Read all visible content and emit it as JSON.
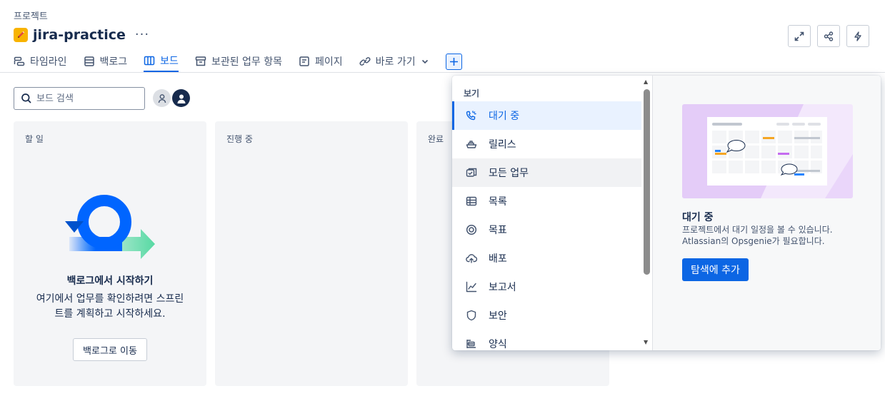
{
  "breadcrumb": "프로젝트",
  "project": {
    "title": "jira-practice",
    "more": "···"
  },
  "tabs": [
    {
      "label": "타임라인",
      "icon": "timeline-icon"
    },
    {
      "label": "백로그",
      "icon": "backlog-icon"
    },
    {
      "label": "보드",
      "icon": "board-icon",
      "active": true
    },
    {
      "label": "보관된 업무 항목",
      "icon": "archive-icon"
    },
    {
      "label": "페이지",
      "icon": "pages-icon"
    },
    {
      "label": "바로 가기",
      "icon": "link-icon"
    }
  ],
  "search": {
    "placeholder": "보드 검색"
  },
  "columns": [
    {
      "title": "할 일"
    },
    {
      "title": "진행 중"
    },
    {
      "title": "완료"
    }
  ],
  "empty_state": {
    "title": "백로그에서 시작하기",
    "description": "여기에서 업무를 확인하려면 스프린트를 계획하고 시작하세요.",
    "button": "백로그로 이동"
  },
  "view_menu": {
    "heading": "보기",
    "items": [
      {
        "label": "대기 중",
        "icon": "on-call-icon",
        "state": "selected"
      },
      {
        "label": "릴리스",
        "icon": "release-ship-icon"
      },
      {
        "label": "모든 업무",
        "icon": "all-work-icon",
        "state": "hover"
      },
      {
        "label": "목록",
        "icon": "list-table-icon"
      },
      {
        "label": "목표",
        "icon": "goal-icon"
      },
      {
        "label": "배포",
        "icon": "deploy-cloud-icon"
      },
      {
        "label": "보고서",
        "icon": "reports-chart-icon"
      },
      {
        "label": "보안",
        "icon": "security-shield-icon"
      },
      {
        "label": "양식",
        "icon": "forms-icon"
      }
    ]
  },
  "preview": {
    "title": "대기 중",
    "description": "프로젝트에서 대기 일정을 볼 수 있습니다. Atlassian의 Opsgenie가 필요합니다.",
    "button": "탐색에 추가"
  },
  "colors": {
    "accent": "#0c66e4",
    "project_icon": "#f8b300",
    "column_bg": "#f4f5f7"
  }
}
